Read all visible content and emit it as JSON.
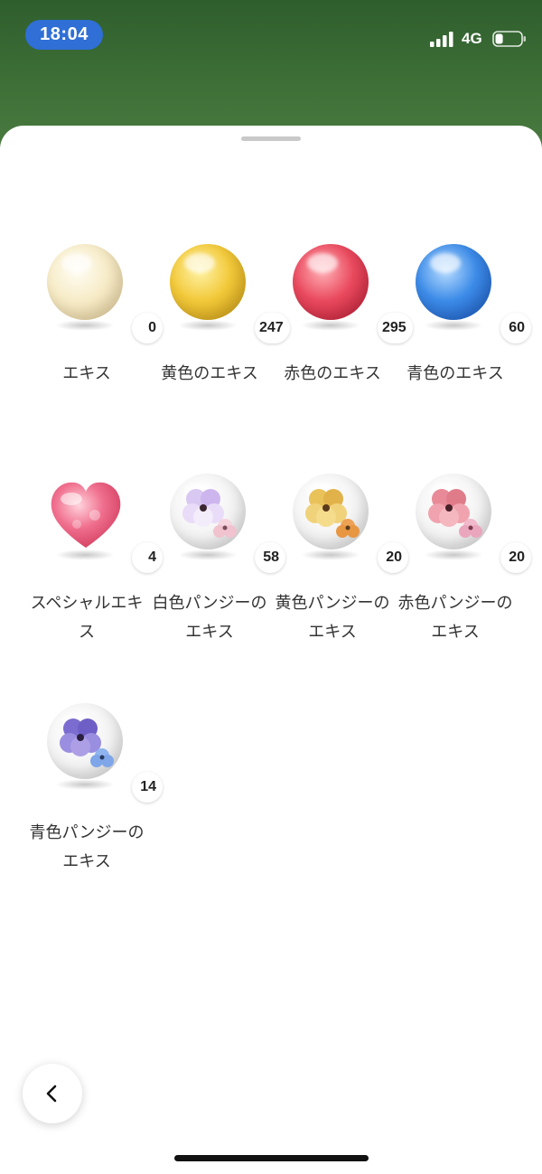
{
  "status_bar": {
    "time": "18:04",
    "network": "4G",
    "signal_icon": "cellular-signal-icon",
    "battery_icon": "battery-icon",
    "battery_level": 0.3
  },
  "items": [
    {
      "label": "エキス",
      "count": "0",
      "icon": "cream-orb-icon",
      "color": "#f5e6c0"
    },
    {
      "label": "黄色のエキス",
      "count": "247",
      "icon": "yellow-orb-icon",
      "color": "#f2c93a"
    },
    {
      "label": "赤色のエキス",
      "count": "295",
      "icon": "red-orb-icon",
      "color": "#ea4a5e"
    },
    {
      "label": "青色のエキス",
      "count": "60",
      "icon": "blue-orb-icon",
      "color": "#3d8ce8"
    },
    {
      "label": "スペシャルエキス",
      "count": "4",
      "icon": "pink-heart-icon",
      "color": "#f06f8e"
    },
    {
      "label": "白色パンジーのエキス",
      "count": "58",
      "icon": "white-pansy-orb-icon",
      "color": "#c7b5e6"
    },
    {
      "label": "黄色パンジーのエキス",
      "count": "20",
      "icon": "yellow-pansy-orb-icon",
      "color": "#e9b84a"
    },
    {
      "label": "赤色パンジーのエキス",
      "count": "20",
      "icon": "red-pansy-orb-icon",
      "color": "#e07b8a"
    },
    {
      "label": "青色パンジーのエキス",
      "count": "14",
      "icon": "blue-pansy-orb-icon",
      "color": "#7b6cd0"
    }
  ],
  "back_button": {
    "icon": "chevron-left-icon"
  }
}
